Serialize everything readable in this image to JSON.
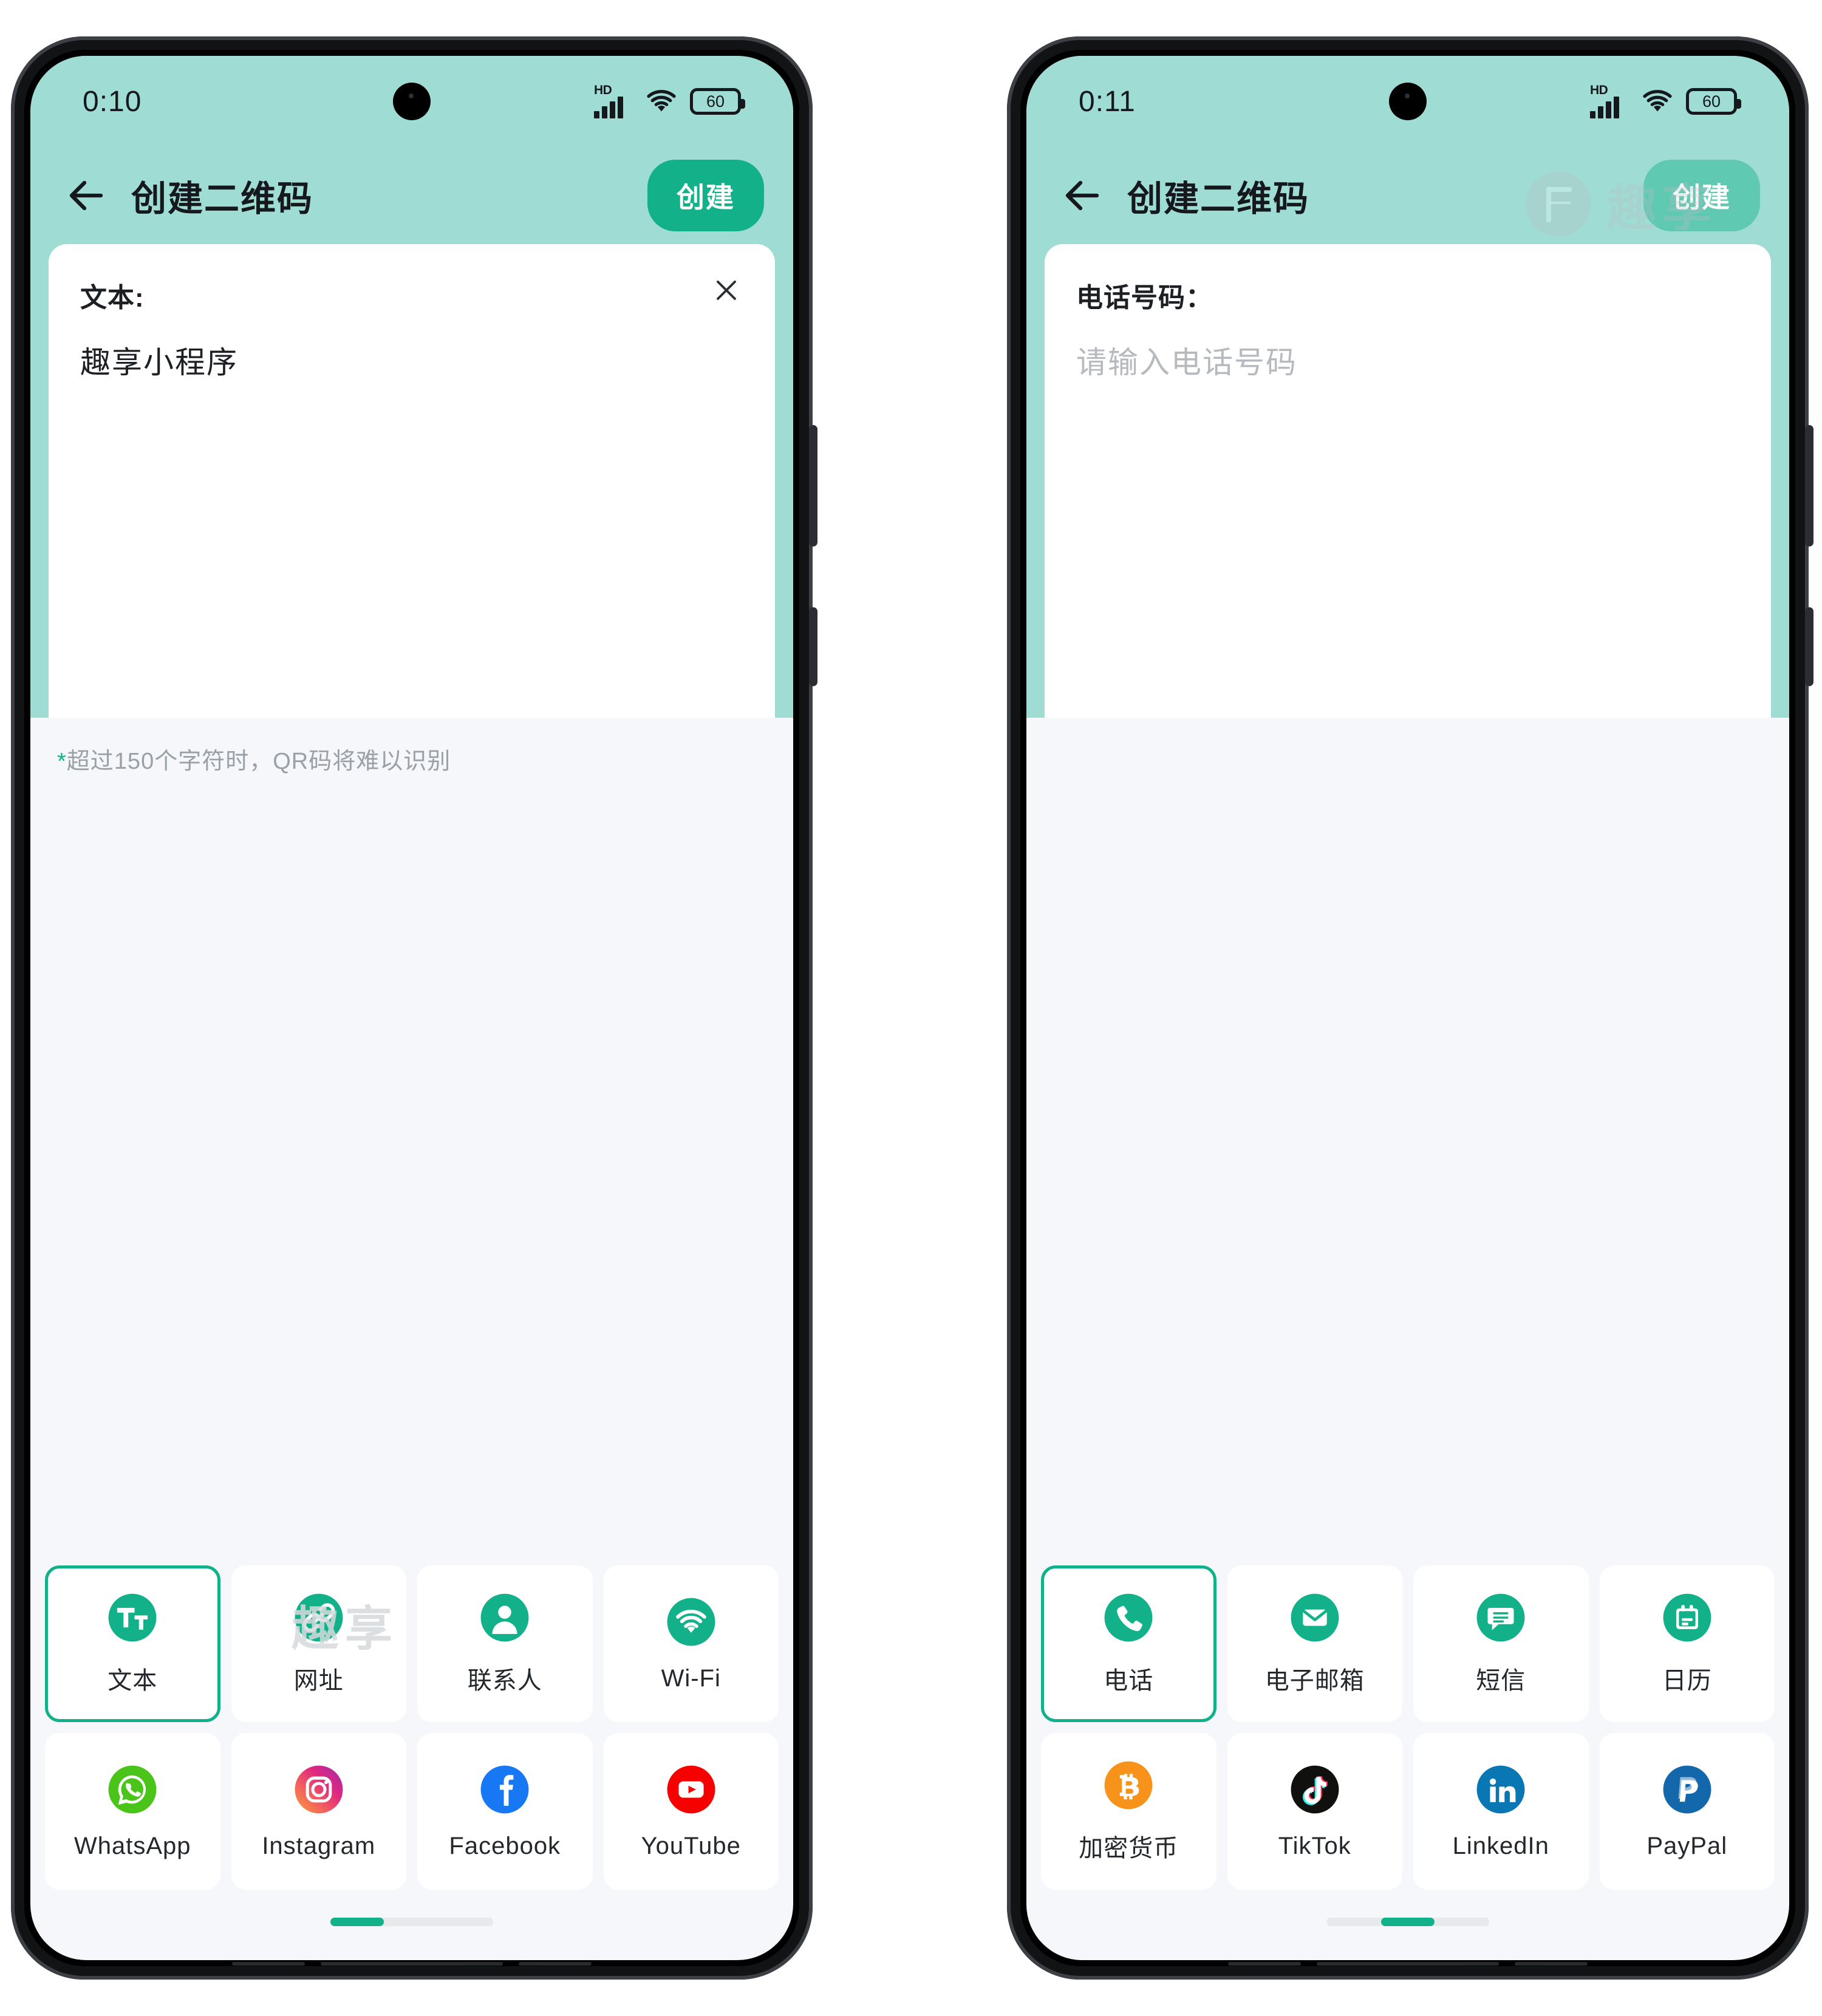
{
  "theme": {
    "accent": "#12b189",
    "header_bg": "#9fdcd3",
    "page_bg": "#f5f7fa",
    "card_bg": "#ffffff",
    "text": "#1c2024",
    "muted": "#9aa0a6"
  },
  "watermark": {
    "brand": "趣享",
    "logo_letter": "F"
  },
  "phones": [
    {
      "id": "phone-left",
      "status": {
        "time": "0:10",
        "network": "HD",
        "battery": "60"
      },
      "appbar": {
        "title": "创建二维码",
        "action_label": "创建",
        "action_enabled": true
      },
      "field": {
        "label": "文本:",
        "value": "趣享小程序",
        "placeholder": "",
        "has_clear": true
      },
      "hint": {
        "star": "*",
        "text": "超过150个字符时，QR码将难以识别"
      },
      "tiles": [
        {
          "label": "文本",
          "icon": "text-tt-icon",
          "selected": true
        },
        {
          "label": "网址",
          "icon": "link-icon",
          "selected": false
        },
        {
          "label": "联系人",
          "icon": "contact-icon",
          "selected": false
        },
        {
          "label": "Wi-Fi",
          "icon": "wifi-icon",
          "selected": false
        },
        {
          "label": "WhatsApp",
          "icon": "whatsapp-icon",
          "selected": false
        },
        {
          "label": "Instagram",
          "icon": "instagram-icon",
          "selected": false
        },
        {
          "label": "Facebook",
          "icon": "facebook-icon",
          "selected": false
        },
        {
          "label": "YouTube",
          "icon": "youtube-icon",
          "selected": false
        }
      ],
      "pager": {
        "position": "start"
      },
      "show_appbar_watermark": false,
      "show_grid_watermark": true
    },
    {
      "id": "phone-right",
      "status": {
        "time": "0:11",
        "network": "HD",
        "battery": "60"
      },
      "appbar": {
        "title": "创建二维码",
        "action_label": "创建",
        "action_enabled": false
      },
      "field": {
        "label": "电话号码：",
        "value": "",
        "placeholder": "请输入电话号码",
        "has_clear": false
      },
      "hint": {
        "star": "",
        "text": ""
      },
      "tiles": [
        {
          "label": "电话",
          "icon": "phone-icon",
          "selected": true
        },
        {
          "label": "电子邮箱",
          "icon": "email-icon",
          "selected": false
        },
        {
          "label": "短信",
          "icon": "sms-icon",
          "selected": false
        },
        {
          "label": "日历",
          "icon": "calendar-icon",
          "selected": false
        },
        {
          "label": "加密货币",
          "icon": "bitcoin-icon",
          "selected": false
        },
        {
          "label": "TikTok",
          "icon": "tiktok-icon",
          "selected": false
        },
        {
          "label": "LinkedIn",
          "icon": "linkedin-icon",
          "selected": false
        },
        {
          "label": "PayPal",
          "icon": "paypal-icon",
          "selected": false
        }
      ],
      "pager": {
        "position": "mid"
      },
      "show_appbar_watermark": true,
      "show_grid_watermark": false
    }
  ]
}
